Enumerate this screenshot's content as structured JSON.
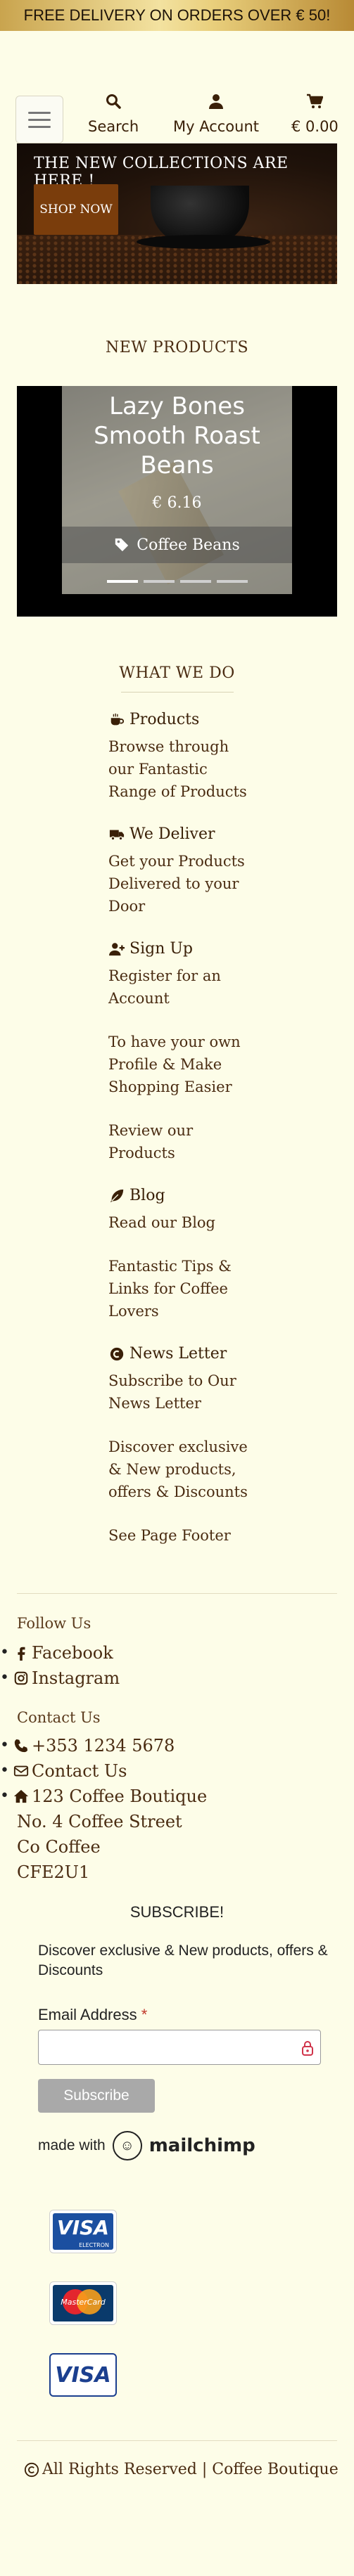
{
  "banner": {
    "text": "FREE DELIVERY ON ORDERS OVER € 50!"
  },
  "nav": {
    "menu_icon": "hamburger-icon",
    "search": {
      "label": "Search",
      "icon": "search-icon"
    },
    "account": {
      "label": "My Account",
      "icon": "user-icon"
    },
    "cart": {
      "label": "€ 0.00",
      "icon": "cart-icon"
    }
  },
  "hero": {
    "title": "THE NEW COLLECTIONS ARE HERE !",
    "button": "SHOP NOW"
  },
  "new_products": {
    "title": "NEW PRODUCTS",
    "items": [
      {
        "name": "Lazy Bones Smooth Roast Beans",
        "price": "€ 6.16",
        "category": "Coffee Beans",
        "category_icon": "tag-icon"
      }
    ],
    "slide_count": 4,
    "active_slide": 1
  },
  "what_we_do": {
    "title": "WHAT WE DO",
    "sections": [
      {
        "heading": "Products",
        "icon": "coffee-cup-icon",
        "lines": [
          "Browse through our Fantastic Range of Products"
        ]
      },
      {
        "heading": "We Deliver",
        "icon": "truck-icon",
        "lines": [
          "Get your Products Delivered to your Door"
        ]
      },
      {
        "heading": "Sign Up",
        "icon": "user-plus-icon",
        "lines": [
          "Register for an Account",
          "To have your own Profile & Make Shopping Easier",
          "Review our Products"
        ]
      },
      {
        "heading": "Blog",
        "icon": "feather-icon",
        "lines": [
          "Read our Blog",
          "Fantastic Tips & Links for Coffee Lovers"
        ]
      },
      {
        "heading": "News Letter",
        "icon": "copyright-like-icon",
        "lines": [
          "Subscribe to Our News Letter",
          "Discover exclusive & New products, offers & Discounts",
          "See Page Footer"
        ]
      }
    ]
  },
  "footer": {
    "follow_title": "Follow Us",
    "social": [
      {
        "label": "Facebook",
        "icon": "facebook-icon"
      },
      {
        "label": "Instagram",
        "icon": "instagram-icon"
      }
    ],
    "contact_title": "Contact Us",
    "contact": [
      {
        "label": "+353 1234 5678",
        "icon": "phone-icon"
      },
      {
        "label": "Contact Us",
        "icon": "envelope-icon"
      },
      {
        "label": "123 Coffee Boutique",
        "icon": "home-icon"
      }
    ],
    "address": [
      "No. 4 Coffee Street",
      "Co Coffee",
      "CFE2U1"
    ],
    "subscribe": {
      "title": "SUBSCRIBE!",
      "description": "Discover exclusive & New products, offers & Discounts",
      "email_label": "Email Address",
      "required_mark": "*",
      "email_value": "",
      "button": "Subscribe",
      "made_with": "made with",
      "provider": "mailchimp"
    },
    "cards": [
      {
        "name": "VISA",
        "sub": "ELECTRON"
      },
      {
        "name": "MasterCard"
      },
      {
        "name": "VISA"
      }
    ],
    "copyright": "All Rights Reserved | Coffee Boutique"
  },
  "colors": {
    "brand": "#4a2c12",
    "background": "#fdfde8",
    "shop_button": "#7a3d0c"
  }
}
